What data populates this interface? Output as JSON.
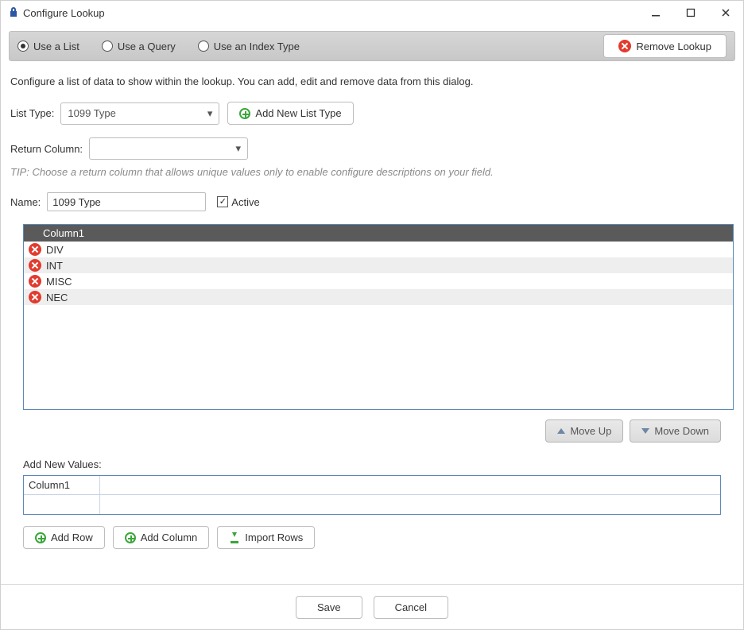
{
  "window": {
    "title": "Configure Lookup"
  },
  "topbar": {
    "options": {
      "use_list": "Use a List",
      "use_query": "Use a Query",
      "use_index": "Use an Index Type",
      "selected": "use_list"
    },
    "remove_label": "Remove Lookup"
  },
  "intro": "Configure a list of data to show within the lookup. You can add, edit and remove data from this dialog.",
  "list_type": {
    "label": "List Type:",
    "value": "1099 Type",
    "add_button": "Add New List Type"
  },
  "return_column": {
    "label": "Return Column:",
    "value": ""
  },
  "tip": "TIP: Choose a return column that allows unique values only to enable configure descriptions on your field.",
  "name": {
    "label": "Name:",
    "value": "1099 Type",
    "active_label": "Active",
    "active_checked": true
  },
  "grid": {
    "header": "Column1",
    "rows": [
      "DIV",
      "INT",
      "MISC",
      "NEC"
    ]
  },
  "move": {
    "up": "Move Up",
    "down": "Move Down"
  },
  "add_new": {
    "label": "Add New Values:",
    "header": "Column1"
  },
  "action_buttons": {
    "add_row": "Add Row",
    "add_column": "Add Column",
    "import_rows": "Import Rows"
  },
  "footer": {
    "save": "Save",
    "cancel": "Cancel"
  }
}
